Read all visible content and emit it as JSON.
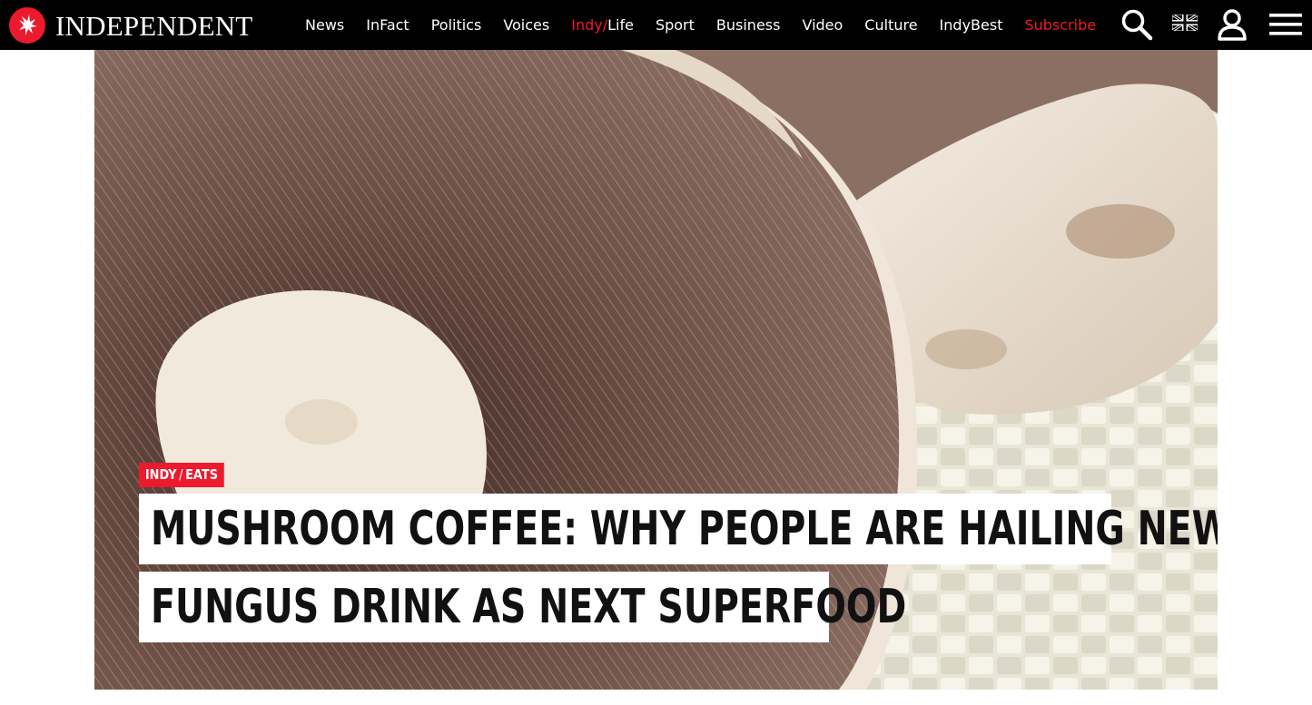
{
  "brand": {
    "name": "INDEPENDENT",
    "accent_color": "#ec1a2e"
  },
  "nav": {
    "items": [
      {
        "label": "News"
      },
      {
        "label": "InFact"
      },
      {
        "label": "Politics"
      },
      {
        "label": "Voices"
      },
      {
        "label_prefix": "Indy/",
        "label_suffix": "Life"
      },
      {
        "label": "Sport"
      },
      {
        "label": "Business"
      },
      {
        "label": "Video"
      },
      {
        "label": "Culture"
      },
      {
        "label": "IndyBest"
      }
    ],
    "subscribe_label": "Subscribe",
    "tools": [
      "search-icon",
      "uk-flag-icon",
      "account-icon",
      "hamburger-menu-icon"
    ]
  },
  "hero": {
    "category_left": "INDY",
    "category_slash": "/",
    "category_right": "EATS",
    "headline_line1": "MUSHROOM COFFEE: WHY PEOPLE ARE HAILING NEW",
    "headline_line2": "FUNGUS DRINK AS NEXT SUPERFOOD",
    "image_subject": "Close-up of portobello mushroom caps showing gills on a woven mat"
  }
}
